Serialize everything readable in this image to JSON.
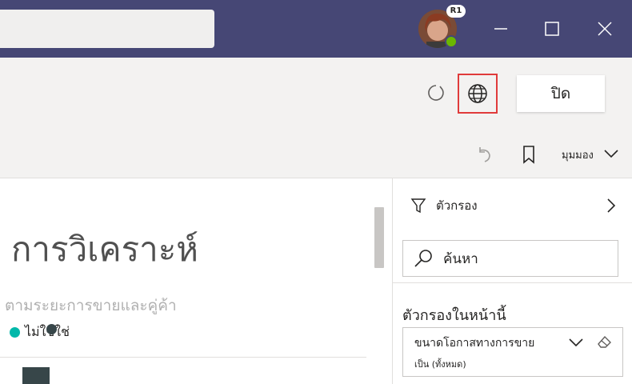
{
  "titlebar": {
    "avatar_badge": "R1",
    "window_buttons": [
      "minimize",
      "maximize",
      "close"
    ]
  },
  "toolbar": {
    "close_label": "ปิด",
    "view_label": "มุมมอง"
  },
  "report": {
    "title": "การวิเคราะห์",
    "subtitle": "ตามระยะการขายและคู่ค้า",
    "legend_text": "ไม่ใช่ใช่"
  },
  "filters_pane": {
    "title": "ตัวกรอง",
    "search_placeholder": "ค้นหา",
    "section_title": "ตัวกรองในหน้านี้",
    "filter_card": {
      "name": "ขนาดโอกาสทางการขาย",
      "value": "เป็น (ทั้งหมด)"
    }
  },
  "colors": {
    "titlebar": "#464775",
    "accent_highlight": "#e03b3b",
    "legend_teal": "#01b8aa",
    "legend_dark": "#374649",
    "presence": "#6bb700"
  }
}
